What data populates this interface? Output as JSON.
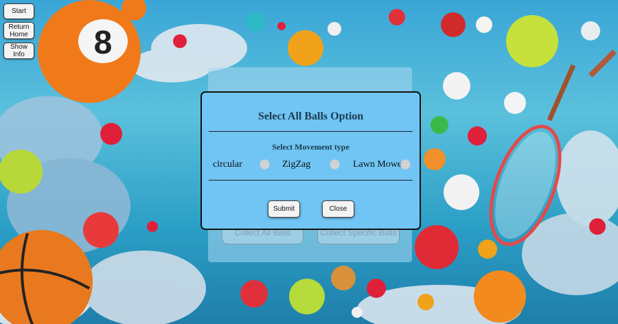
{
  "sidebar": {
    "start_label": "Start",
    "return_home_label": "Return Home",
    "show_info_label": "Show Info"
  },
  "background_panel": {
    "collect_all_label": "Collect All Balls",
    "collect_specific_label": "Collect Specific Balls"
  },
  "modal": {
    "title": "Select All Balls Option",
    "subtitle": "Select Movement type",
    "options": [
      {
        "label": "circular",
        "selected": false
      },
      {
        "label": "ZigZag",
        "selected": false
      },
      {
        "label": "Lawn Mower",
        "selected": false
      }
    ],
    "submit_label": "Submit",
    "close_label": "Close"
  },
  "colors": {
    "modal_bg": "#70c5f4",
    "sky": "#3aa6d6"
  }
}
